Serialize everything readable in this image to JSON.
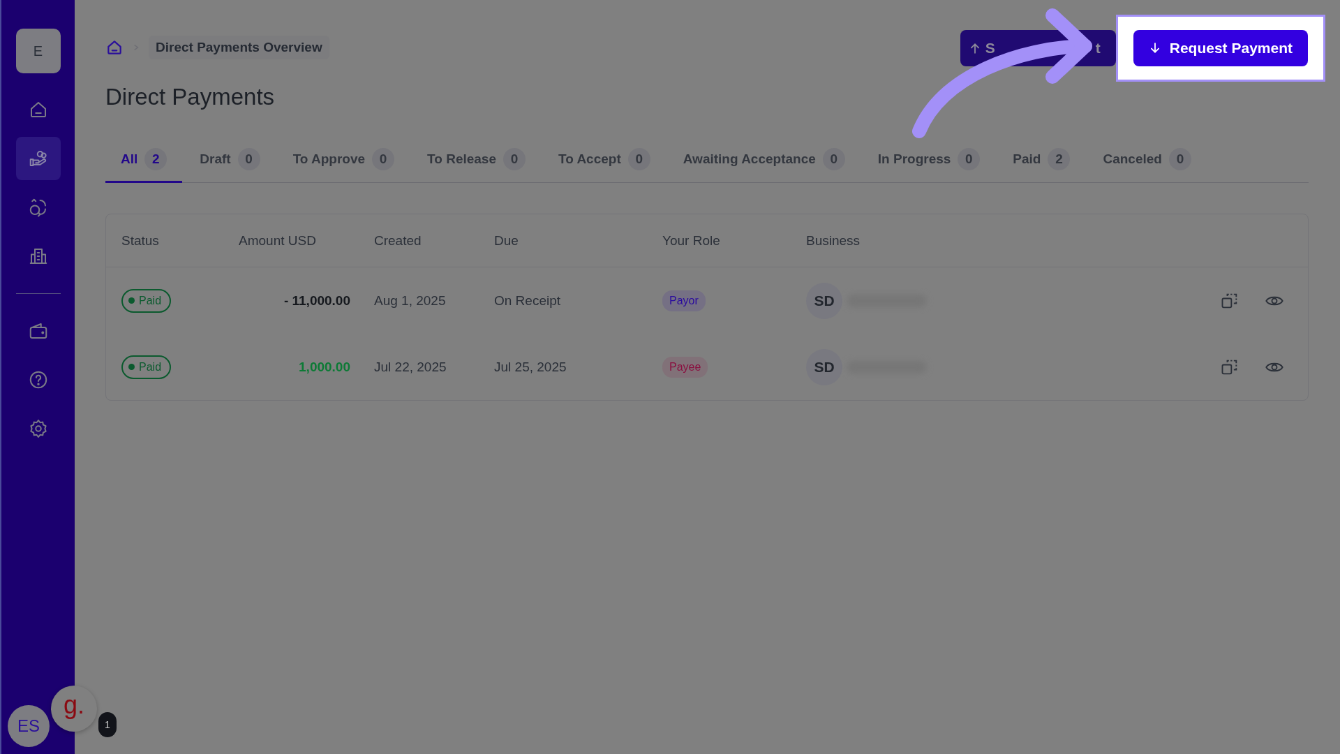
{
  "sidebar": {
    "workspace_initial": "E",
    "main_items": [
      {
        "selected": false
      },
      {
        "selected": true
      },
      {
        "selected": false
      },
      {
        "selected": false
      }
    ],
    "bottom_items": [
      {
        "selected": false
      },
      {
        "selected": false
      },
      {
        "selected": false
      }
    ],
    "user_initials": "ES",
    "widget": {
      "logo": "g.",
      "badge": "1"
    }
  },
  "breadcrumb": {
    "current": "Direct Payments Overview"
  },
  "title": "Direct Payments",
  "send_button": {
    "label_start": "S",
    "label_end": "t"
  },
  "request_button": {
    "label": "Request Payment",
    "highlighted": true
  },
  "tabs": [
    {
      "label": "All",
      "count": "2",
      "selected": true
    },
    {
      "label": "Draft",
      "count": "0",
      "selected": false
    },
    {
      "label": "To Approve",
      "count": "0",
      "selected": false
    },
    {
      "label": "To Release",
      "count": "0",
      "selected": false
    },
    {
      "label": "To Accept",
      "count": "0",
      "selected": false
    },
    {
      "label": "Awaiting Acceptance",
      "count": "0",
      "selected": false
    },
    {
      "label": "In Progress",
      "count": "0",
      "selected": false
    },
    {
      "label": "Paid",
      "count": "2",
      "selected": false
    },
    {
      "label": "Canceled",
      "count": "0",
      "selected": false
    }
  ],
  "table": {
    "columns": [
      "Status",
      "Amount USD",
      "Created",
      "Due",
      "Your Role",
      "Business"
    ],
    "rows": [
      {
        "status": "Paid",
        "amount": {
          "text": "- 11,000.00",
          "color": "#15181d"
        },
        "created": "Aug 1, 2025",
        "due": "On Receipt",
        "role": {
          "text": "Payor",
          "color": "#2a0a9e"
        },
        "business_initials": "SD"
      },
      {
        "status": "Paid",
        "amount": {
          "text": "1,000.00",
          "color": "#0c7a35"
        },
        "created": "Jul 22, 2025",
        "due": "Jul 25, 2025",
        "role": {
          "text": "Payee",
          "color": "#8a1040"
        },
        "business_initials": "SD"
      }
    ]
  }
}
